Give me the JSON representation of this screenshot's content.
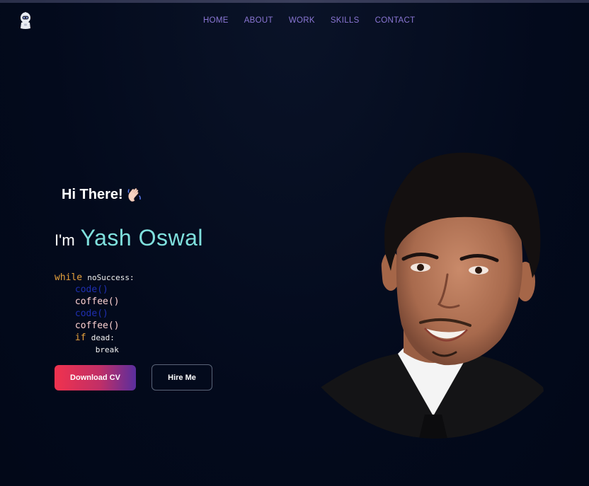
{
  "nav": {
    "items": [
      {
        "label": "HOME"
      },
      {
        "label": "ABOUT"
      },
      {
        "label": "WORK"
      },
      {
        "label": "SKILLS"
      },
      {
        "label": "CONTACT"
      }
    ]
  },
  "hero": {
    "greeting": "Hi There!",
    "intro_prefix": "I'm",
    "name": "Yash Oswal",
    "code": {
      "line1_kw": "while",
      "line1_rest": "noSuccess:",
      "line2": "code()",
      "line3": "coffee()",
      "line4": "code()",
      "line5": "coffee()",
      "line6_kw": "if",
      "line6_rest": "dead:",
      "line7": "break"
    },
    "buttons": {
      "download": "Download CV",
      "hire": "Hire Me"
    }
  },
  "icons": {
    "logo": "astronaut-logo-icon",
    "wave": "waving-hand-icon"
  },
  "colors": {
    "background": "#030a1c",
    "nav_link": "#8a76d4",
    "name_accent": "#7fe0dd",
    "code_keyword": "#e8a33d",
    "primary_button_start": "#f0324e",
    "primary_button_end": "#5a2e9e"
  }
}
